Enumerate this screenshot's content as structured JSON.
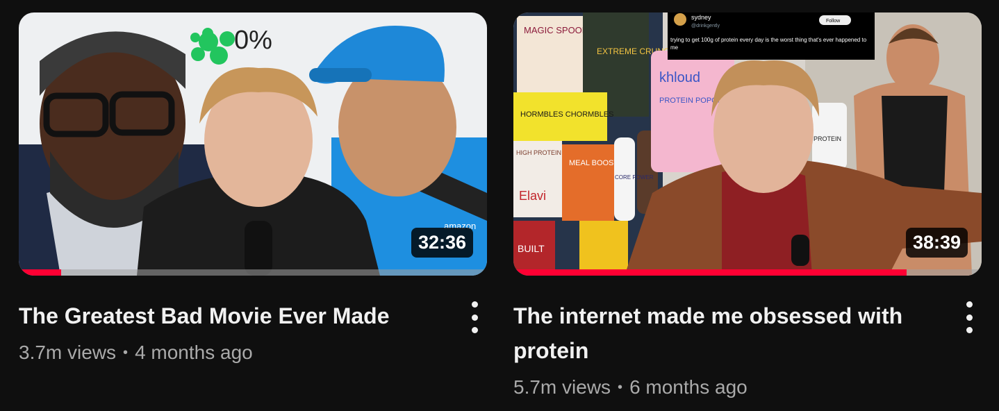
{
  "videos": [
    {
      "title": "The Greatest Bad Movie Ever Made",
      "views": "3.7m views",
      "age": "4 months ago",
      "duration": "32:36",
      "watch_progress": 0.09,
      "thumbnail": {
        "rating_text": "0%",
        "badge_text": "amazon"
      }
    },
    {
      "title": "The internet made me obsessed with protein",
      "views": "5.7m views",
      "age": "6 months ago",
      "duration": "38:39",
      "watch_progress": 0.84,
      "thumbnail": {
        "tweet_user": "sydney",
        "tweet_handle": "@drinkgently",
        "tweet_follow": "Follow",
        "tweet_text": "trying to get 100g of protein every day is the worst thing that's ever happened to me",
        "snack_1": "MAGIC SPOON",
        "snack_2": "EXTREME CRUNCH",
        "snack_3": "khloud",
        "snack_4": "PROTEIN POPCORN",
        "snack_5": "HORMBLES CHORMBLES",
        "snack_6": "MEAL BOOSTERS",
        "snack_7": "CORE POWER",
        "snack_8": "HIGH PROTEIN",
        "snack_9": "Elavi",
        "snack_10": "BUILT",
        "tub_label": "PROTEIN"
      }
    }
  ],
  "colors": {
    "background": "#0f0f0f",
    "progress": "#ff0033",
    "title": "#f1f1f1",
    "meta": "#aaaaaa"
  }
}
